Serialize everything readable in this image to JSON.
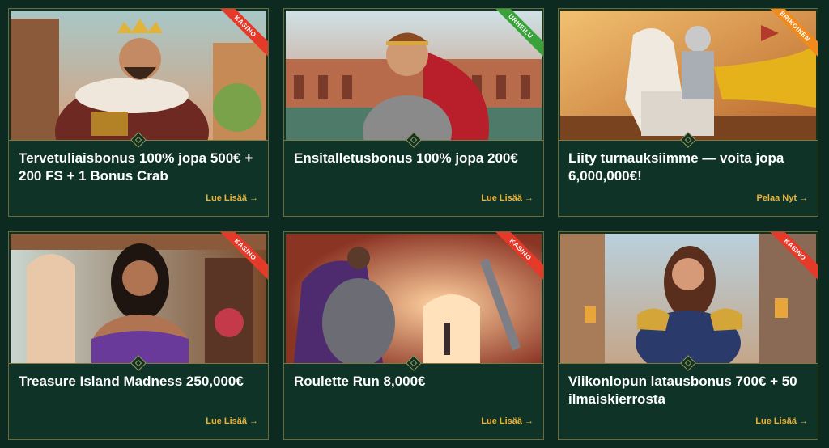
{
  "colors": {
    "page_bg": "#0c2a20",
    "card_bg": "#0f3326",
    "card_border": "#6b6a3c",
    "cta": "#e8b23b",
    "kasino": "#e5392a",
    "urheilu": "#3aa23b",
    "erikoinen": "#f08a1c"
  },
  "cards": [
    {
      "badge": "KASINO",
      "badge_color": "#e5392a",
      "title": "Tervetuliaisbonus 100% jopa 500€ + 200 FS + 1 Bonus Crab",
      "cta": "Lue Lisää",
      "arrow": "→",
      "art": "king-with-treasure-chest"
    },
    {
      "badge": "URHEILU",
      "badge_color": "#3aa23b",
      "title": "Ensitalletusbonus 100% jopa 200€",
      "cta": "Lue Lisää",
      "arrow": "→",
      "art": "gladiator-in-arena"
    },
    {
      "badge": "ERIKOINEN",
      "badge_color": "#f08a1c",
      "title": "Liity turnauksiimme — voita jopa 6,000,000€!",
      "cta": "Pelaa Nyt",
      "arrow": "→",
      "art": "knight-on-white-horse"
    },
    {
      "badge": "KASINO",
      "badge_color": "#e5392a",
      "title": "Treasure Island Madness 250,000€",
      "cta": "Lue Lisää",
      "arrow": "→",
      "art": "woman-in-palace"
    },
    {
      "badge": "KASINO",
      "badge_color": "#e5392a",
      "title": "Roulette Run 8,000€",
      "cta": "Lue Lisää",
      "arrow": "→",
      "art": "knight-in-arena"
    },
    {
      "badge": "KASINO",
      "badge_color": "#e5392a",
      "title": "Viikonlopun latausbonus 700€ + 50 ilmaiskierrosta",
      "cta": "Lue Lisää",
      "arrow": "→",
      "art": "warrior-woman-in-street"
    }
  ]
}
